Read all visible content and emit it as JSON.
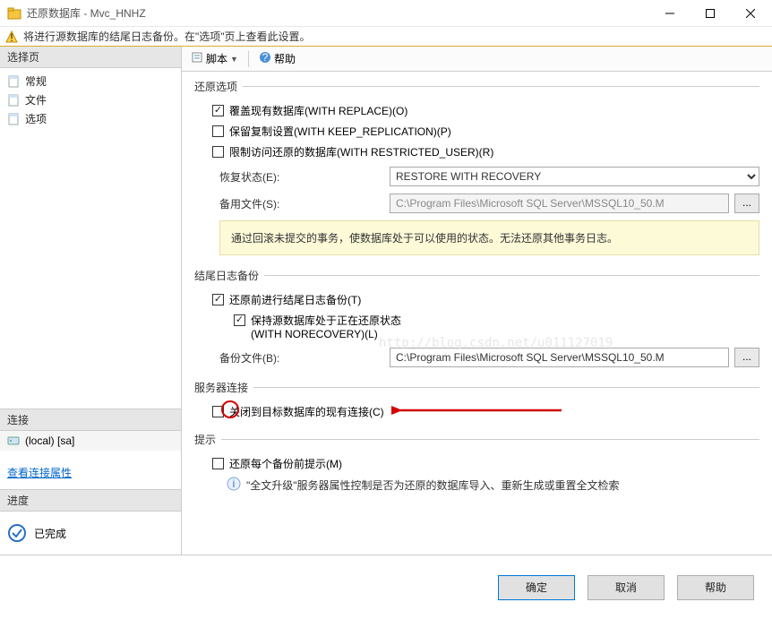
{
  "title": "还原数据库 - Mvc_HNHZ",
  "warning": "将进行源数据库的结尾日志备份。在\"选项\"页上查看此设置。",
  "sidebar": {
    "select_page": "选择页",
    "items": [
      {
        "label": "常规"
      },
      {
        "label": "文件"
      },
      {
        "label": "选项"
      }
    ],
    "connection_head": "连接",
    "connection_value": "(local) [sa]",
    "view_props": "查看连接属性",
    "progress_head": "进度",
    "progress_value": "已完成"
  },
  "toolbar": {
    "script": "脚本",
    "help": "帮助"
  },
  "groups": {
    "restore": {
      "title": "还原选项",
      "overwrite": "覆盖现有数据库(WITH REPLACE)(O)",
      "keep_repl": "保留复制设置(WITH KEEP_REPLICATION)(P)",
      "restricted": "限制访问还原的数据库(WITH RESTRICTED_USER)(R)",
      "state_label": "恢复状态(E):",
      "state_value": "RESTORE WITH RECOVERY",
      "standby_label": "备用文件(S):",
      "standby_value": "C:\\Program Files\\Microsoft SQL Server\\MSSQL10_50.M",
      "note": "通过回滚未提交的事务，使数据库处于可以使用的状态。无法还原其他事务日志。"
    },
    "tail": {
      "title": "结尾日志备份",
      "take_tail": "还原前进行结尾日志备份(T)",
      "norecovery_line1": "保持源数据库处于正在还原状态",
      "norecovery_line2": "(WITH NORECOVERY)(L)",
      "backup_file_label": "备份文件(B):",
      "backup_file_value": "C:\\Program Files\\Microsoft SQL Server\\MSSQL10_50.M"
    },
    "server": {
      "title": "服务器连接",
      "close_conn": "关闭到目标数据库的现有连接(C)"
    },
    "prompt": {
      "title": "提示",
      "prompt_each": "还原每个备份前提示(M)",
      "info": "\"全文升级\"服务器属性控制是否为还原的数据库导入、重新生成或重置全文检索"
    }
  },
  "buttons": {
    "ok": "确定",
    "cancel": "取消",
    "help": "帮助"
  },
  "watermark": "http://blog.csdn.net/u011127019",
  "ellipsis": "..."
}
